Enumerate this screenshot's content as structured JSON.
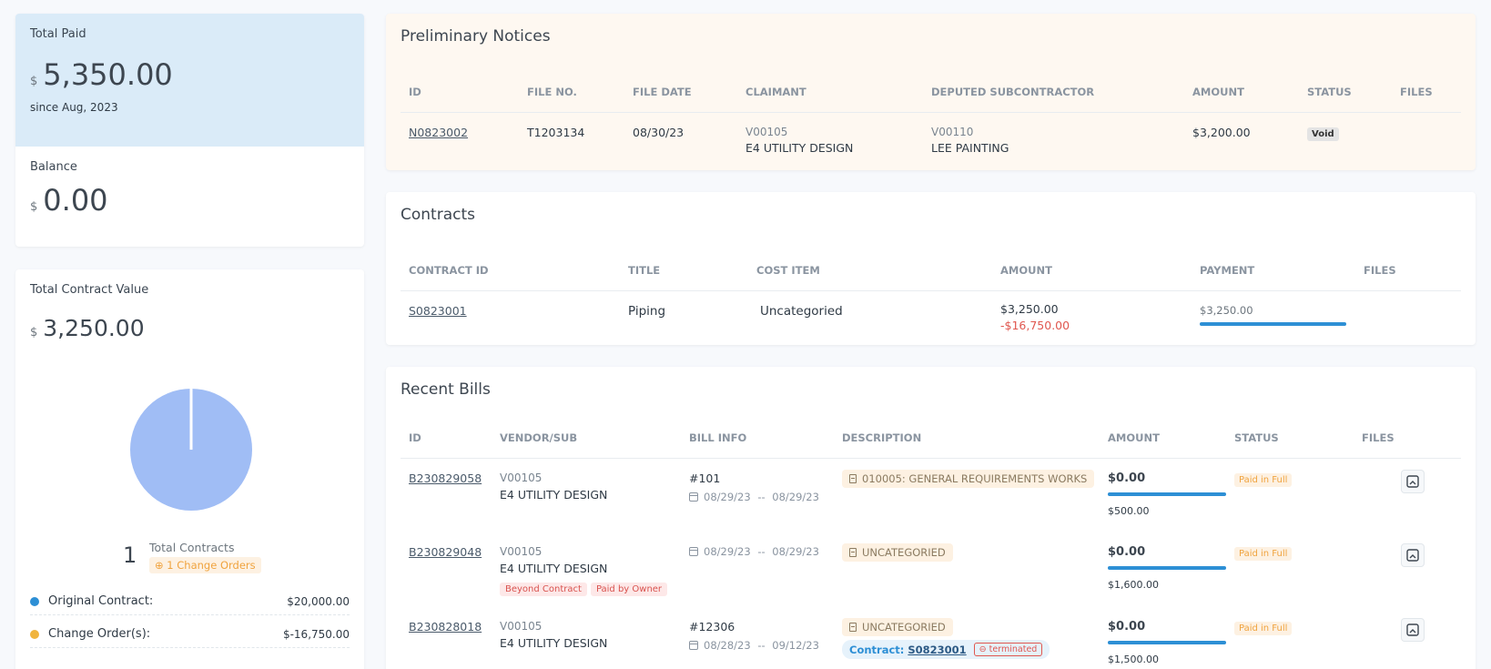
{
  "summary": {
    "total_paid": {
      "label": "Total Paid",
      "currency": "$",
      "value": "5,350.00",
      "since": "since Aug, 2023"
    },
    "balance": {
      "label": "Balance",
      "currency": "$",
      "value": "0.00"
    },
    "contract_value": {
      "label": "Total Contract Value",
      "currency": "$",
      "value": "3,250.00",
      "count": "1",
      "count_label": "Total Contracts",
      "change_orders": "1 Change Orders",
      "legend": [
        {
          "label": "Original Contract:",
          "value": "$20,000.00",
          "color": "#2d8fd5"
        },
        {
          "label": "Change Order(s):",
          "value": "$-16,750.00",
          "color": "#f0b43e"
        }
      ]
    }
  },
  "chart_data": {
    "type": "pie",
    "categories": [
      "Original Contract",
      "Change Order(s)"
    ],
    "values": [
      20000,
      -16750
    ],
    "colors": [
      "#a0bdf5",
      "#ffffff"
    ]
  },
  "prelim": {
    "title": "Preliminary Notices",
    "headers": [
      "ID",
      "FILE NO.",
      "FILE DATE",
      "CLAIMANT",
      "DEPUTED SUBCONTRACTOR",
      "AMOUNT",
      "STATUS",
      "FILES"
    ],
    "rows": [
      {
        "id": "N0823002",
        "file_no": "T1203134",
        "file_date": "08/30/23",
        "claimant_code": "V00105",
        "claimant_name": "E4 UTILITY DESIGN",
        "sub_code": "V00110",
        "sub_name": "LEE PAINTING",
        "amount": "$3,200.00",
        "status": "Void"
      }
    ]
  },
  "contracts": {
    "title": "Contracts",
    "headers": [
      "CONTRACT ID",
      "TITLE",
      "COST ITEM",
      "AMOUNT",
      "PAYMENT",
      "FILES"
    ],
    "rows": [
      {
        "id": "S0823001",
        "title": "Piping",
        "cost_item": "Uncategoried",
        "amount": "$3,250.00",
        "change": "-$16,750.00",
        "payment": "$3,250.00",
        "payment_progress": 1.0
      }
    ]
  },
  "bills": {
    "title": "Recent Bills",
    "headers": [
      "ID",
      "VENDOR/SUB",
      "BILL INFO",
      "DESCRIPTION",
      "AMOUNT",
      "STATUS",
      "FILES"
    ],
    "rows": [
      {
        "id": "B230829058",
        "vendor_code": "V00105",
        "vendor_name": "E4 UTILITY DESIGN",
        "bill_no": "#101",
        "date_from": "08/29/23",
        "date_to": "08/29/23",
        "description": "010005: GENERAL REQUIREMENTS WORKS",
        "amount": "$0.00",
        "total": "$500.00",
        "status": "Paid in Full"
      },
      {
        "id": "B230829048",
        "vendor_code": "V00105",
        "vendor_name": "E4 UTILITY DESIGN",
        "bill_no": "",
        "date_from": "08/29/23",
        "date_to": "08/29/23",
        "description": "UNCATEGORIED",
        "amount": "$0.00",
        "total": "$1,600.00",
        "status": "Paid in Full",
        "tags": [
          "Beyond Contract",
          "Paid by Owner"
        ]
      },
      {
        "id": "B230828018",
        "vendor_code": "V00105",
        "vendor_name": "E4 UTILITY DESIGN",
        "bill_no": "#12306",
        "date_from": "08/28/23",
        "date_to": "09/12/23",
        "description": "UNCATEGORIED",
        "amount": "$0.00",
        "total": "$1,500.00",
        "status": "Paid in Full",
        "contract_label": "Contract:",
        "contract_id": "S0823001",
        "contract_status": "terminated"
      }
    ],
    "date_sep": "--"
  }
}
